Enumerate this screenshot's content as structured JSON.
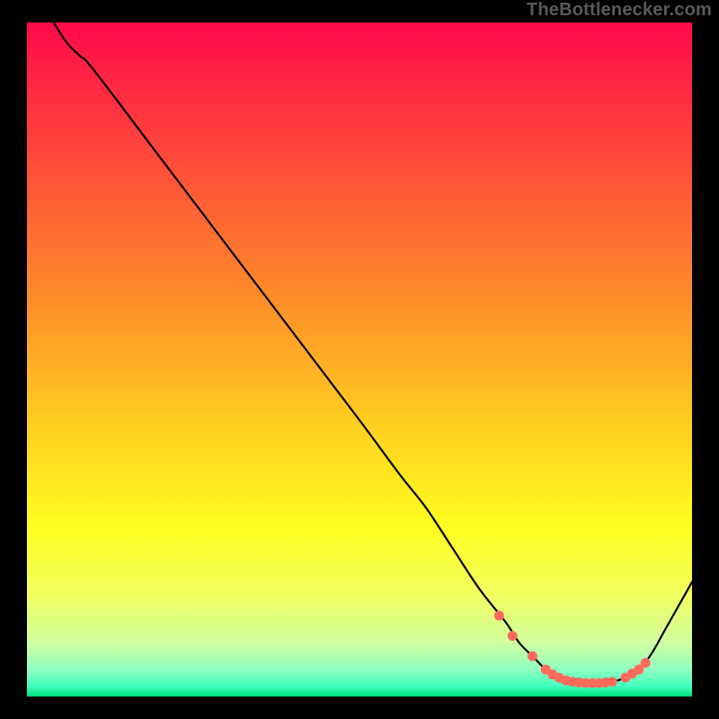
{
  "attribution": "TheBottlenecker.com",
  "chart_data": {
    "type": "line",
    "title": "",
    "xlabel": "",
    "ylabel": "",
    "xlim": [
      0,
      100
    ],
    "ylim": [
      0,
      100
    ],
    "gradient_stops": [
      {
        "p": 0.0,
        "c": "#ff0a4a"
      },
      {
        "p": 0.2,
        "c": "#ff4a3a"
      },
      {
        "p": 0.4,
        "c": "#ff8a2a"
      },
      {
        "p": 0.6,
        "c": "#ffd020"
      },
      {
        "p": 0.75,
        "c": "#ffff20"
      },
      {
        "p": 0.85,
        "c": "#f0ff60"
      },
      {
        "p": 0.92,
        "c": "#d0ffa0"
      },
      {
        "p": 0.96,
        "c": "#90ffc0"
      },
      {
        "p": 0.985,
        "c": "#40ffc0"
      },
      {
        "p": 1.0,
        "c": "#00e079"
      }
    ],
    "series": [
      {
        "name": "curve",
        "x": [
          4,
          6,
          8,
          10,
          20,
          30,
          40,
          50,
          56,
          60,
          64,
          68,
          72,
          74,
          76,
          78,
          79,
          80,
          81,
          82,
          84,
          86,
          88,
          90,
          92,
          94,
          96,
          100
        ],
        "y": [
          100,
          97,
          95,
          93,
          80,
          67,
          54,
          41,
          33,
          28,
          22,
          16,
          11,
          8,
          6,
          4,
          3.3,
          2.8,
          2.4,
          2.2,
          2.0,
          2.0,
          2.2,
          2.8,
          4,
          6.5,
          10,
          17
        ]
      }
    ],
    "markers": {
      "name": "highlight-points",
      "color": "#ff6a5a",
      "x": [
        71,
        73,
        76,
        78,
        79,
        80,
        81,
        82,
        83,
        84,
        85,
        86,
        87,
        88,
        90,
        91,
        92,
        93
      ],
      "y": [
        12,
        9,
        6,
        4,
        3.3,
        2.8,
        2.4,
        2.2,
        2.1,
        2.0,
        2.0,
        2.0,
        2.1,
        2.2,
        2.8,
        3.4,
        4.0,
        5.0
      ]
    }
  }
}
